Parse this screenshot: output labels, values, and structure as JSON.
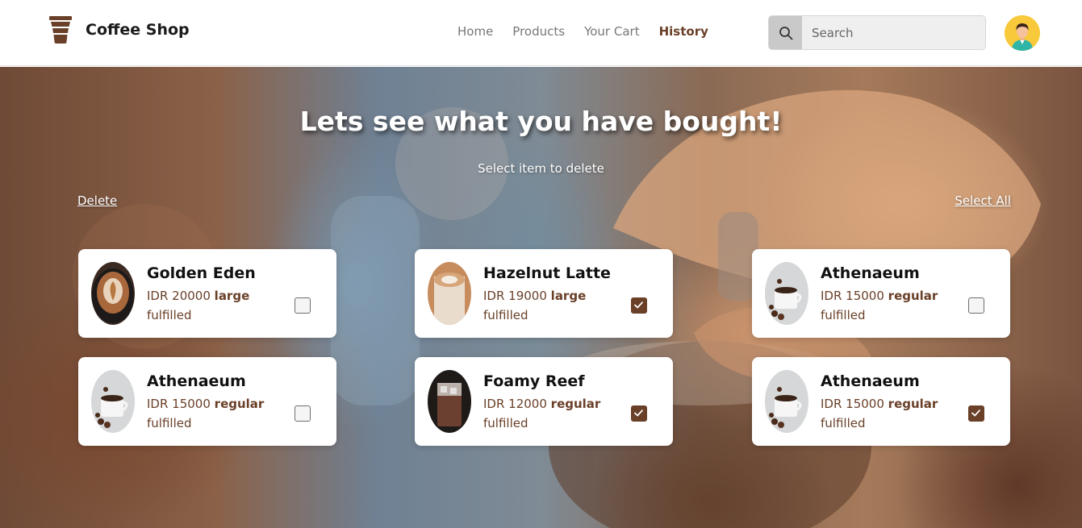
{
  "brand": {
    "name": "Coffee Shop",
    "icon": "coffee-cup-icon"
  },
  "nav": {
    "links": [
      {
        "label": "Home",
        "active": false
      },
      {
        "label": "Products",
        "active": false
      },
      {
        "label": "Your Cart",
        "active": false
      },
      {
        "label": "History",
        "active": true
      }
    ]
  },
  "search": {
    "placeholder": "Search",
    "value": "",
    "icon": "search-icon"
  },
  "user": {
    "avatar_icon": "user-avatar-icon"
  },
  "hero": {
    "title": "Lets see what you have bought!",
    "subtitle": "Select item to delete",
    "delete_label": "Delete",
    "select_all_label": "Select All"
  },
  "items": [
    {
      "name": "Golden Eden",
      "price": "IDR 20000",
      "size": "large",
      "status": "fulfilled",
      "checked": false,
      "image": "latte-art-dark-cup"
    },
    {
      "name": "Hazelnut Latte",
      "price": "IDR 19000",
      "size": "large",
      "status": "fulfilled",
      "checked": true,
      "image": "latte-art-glass"
    },
    {
      "name": "Athenaeum",
      "price": "IDR 15000",
      "size": "regular",
      "status": "fulfilled",
      "checked": false,
      "image": "coffee-cup-beans"
    },
    {
      "name": "Athenaeum",
      "price": "IDR 15000",
      "size": "regular",
      "status": "fulfilled",
      "checked": false,
      "image": "coffee-cup-beans"
    },
    {
      "name": "Foamy Reef",
      "price": "IDR 12000",
      "size": "regular",
      "status": "fulfilled",
      "checked": true,
      "image": "iced-coffee-glass"
    },
    {
      "name": "Athenaeum",
      "price": "IDR 15000",
      "size": "regular",
      "status": "fulfilled",
      "checked": true,
      "image": "coffee-cup-beans"
    }
  ],
  "colors": {
    "accent": "#6a4029",
    "checkbox_checked": "#6a4029"
  }
}
